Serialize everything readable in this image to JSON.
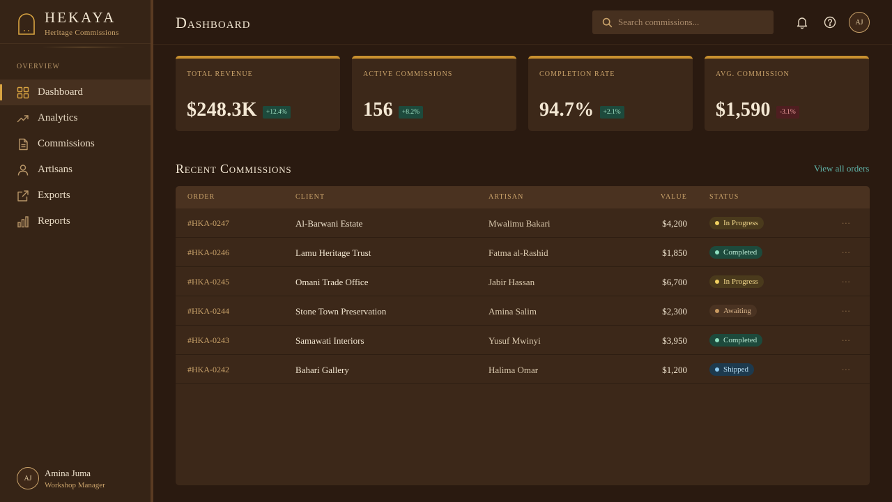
{
  "brand": {
    "name": "HEKAYA",
    "subtitle": "Heritage Commissions"
  },
  "nav": {
    "section_label": "OVERVIEW",
    "items": [
      {
        "label": "Dashboard",
        "icon": "grid-icon",
        "active": true
      },
      {
        "label": "Analytics",
        "icon": "trending-up-icon"
      },
      {
        "label": "Commissions",
        "icon": "document-icon"
      },
      {
        "label": "Artisans",
        "icon": "user-icon"
      },
      {
        "label": "Exports",
        "icon": "external-link-icon"
      },
      {
        "label": "Reports",
        "icon": "bar-chart-icon"
      }
    ]
  },
  "user": {
    "initials": "AJ",
    "name": "Amina Juma",
    "role": "Workshop Manager"
  },
  "header": {
    "title": "Dashboard",
    "search_placeholder": "Search commissions...",
    "avatar_initials": "AJ"
  },
  "stats": [
    {
      "label": "Total Revenue",
      "value": "$248.3K",
      "delta": "+12.4%",
      "trend": "up"
    },
    {
      "label": "Active Commissions",
      "value": "156",
      "delta": "+8.2%",
      "trend": "up"
    },
    {
      "label": "Completion Rate",
      "value": "94.7%",
      "delta": "+2.1%",
      "trend": "up"
    },
    {
      "label": "Avg. Commission",
      "value": "$1,590",
      "delta": "-3.1%",
      "trend": "down"
    }
  ],
  "recent": {
    "title": "Recent Commissions",
    "view_all": "View all orders",
    "columns": [
      "Order",
      "Client",
      "Artisan",
      "Value",
      "Status"
    ],
    "rows": [
      {
        "order": "#HKA-0247",
        "client": "Al-Barwani Estate",
        "artisan": "Mwalimu Bakari",
        "value": "$4,200",
        "status": "In Progress"
      },
      {
        "order": "#HKA-0246",
        "client": "Lamu Heritage Trust",
        "artisan": "Fatma al-Rashid",
        "value": "$1,850",
        "status": "Completed"
      },
      {
        "order": "#HKA-0245",
        "client": "Omani Trade Office",
        "artisan": "Jabir Hassan",
        "value": "$6,700",
        "status": "In Progress"
      },
      {
        "order": "#HKA-0244",
        "client": "Stone Town Preservation",
        "artisan": "Amina Salim",
        "value": "$2,300",
        "status": "Awaiting"
      },
      {
        "order": "#HKA-0243",
        "client": "Samawati Interiors",
        "artisan": "Yusuf Mwinyi",
        "value": "$3,950",
        "status": "Completed"
      },
      {
        "order": "#HKA-0242",
        "client": "Bahari Gallery",
        "artisan": "Halima Omar",
        "value": "$1,200",
        "status": "Shipped"
      }
    ],
    "more_label": "..."
  },
  "status_colors": {
    "In Progress": {
      "bg": "#4a3a1c",
      "fg": "#f0d68a",
      "dot": "#f0d060"
    },
    "Completed": {
      "bg": "#1d4a3c",
      "fg": "#bdebd6",
      "dot": "#8fe0c0"
    },
    "Awaiting": {
      "bg": "#4a3322",
      "fg": "#d8b48a",
      "dot": "#c99a60"
    },
    "Shipped": {
      "bg": "#1d3a4e",
      "fg": "#b8dcf0",
      "dot": "#8cc8ee"
    }
  },
  "colors": {
    "accent": "#d9a441",
    "link": "#5fb3a8",
    "positive": "#9fe0c3",
    "negative": "#f0a0a0"
  }
}
